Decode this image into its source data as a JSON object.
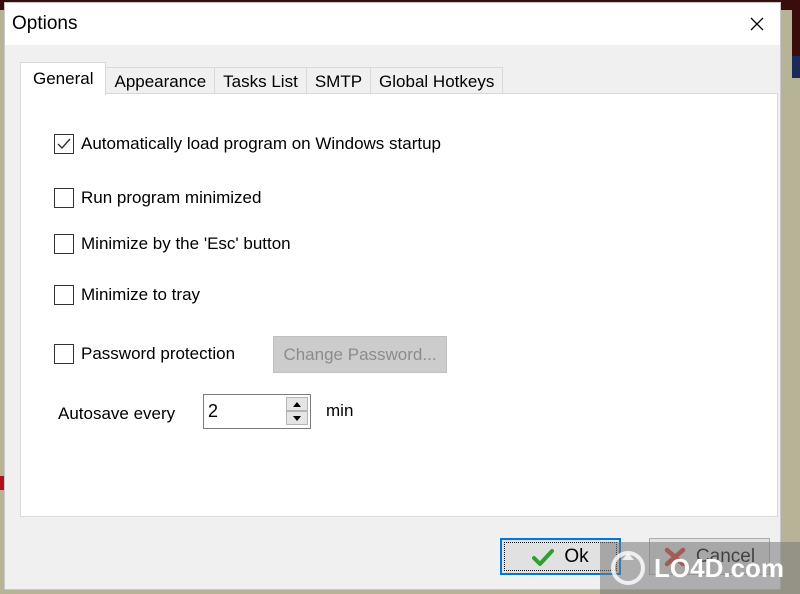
{
  "dialog": {
    "title": "Options",
    "close_label": "Close"
  },
  "tabs": [
    {
      "label": "General",
      "active": true
    },
    {
      "label": "Appearance",
      "active": false
    },
    {
      "label": "Tasks List",
      "active": false
    },
    {
      "label": "SMTP",
      "active": false
    },
    {
      "label": "Global Hotkeys",
      "active": false
    }
  ],
  "general": {
    "options": [
      {
        "label": "Automatically load program on Windows startup",
        "checked": true
      },
      {
        "label": "Run program minimized",
        "checked": false
      },
      {
        "label": "Minimize by the 'Esc' button",
        "checked": false
      },
      {
        "label": "Minimize to tray",
        "checked": false
      },
      {
        "label": "Password protection",
        "checked": false
      }
    ],
    "change_password_label": "Change Password...",
    "autosave_label": "Autosave every",
    "autosave_value": "2",
    "autosave_unit": "min"
  },
  "footer": {
    "ok_label": "Ok",
    "cancel_label": "Cancel"
  },
  "watermark": {
    "text": "LO4D.com"
  }
}
